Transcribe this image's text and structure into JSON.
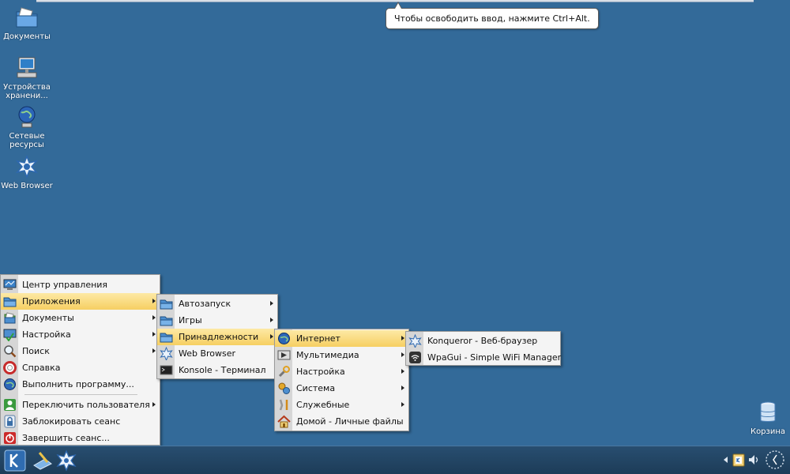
{
  "tooltip": {
    "text": "Чтобы освободить ввод, нажмите Ctrl+Alt."
  },
  "desktop": {
    "icons": [
      {
        "label": "Документы",
        "icon": "folder-documents-icon"
      },
      {
        "label": "Устройства хранени...",
        "icon": "storage-devices-icon"
      },
      {
        "label": "Сетевые ресурсы",
        "icon": "network-resources-icon"
      },
      {
        "label": "Web Browser",
        "icon": "konqueror-icon"
      },
      {
        "label": "Корзина",
        "icon": "trash-icon"
      }
    ]
  },
  "start_menu": {
    "items": [
      {
        "label": "Центр управления",
        "icon": "control-center-icon"
      },
      {
        "label": "Приложения",
        "icon": "applications-folder-icon"
      },
      {
        "label": "Документы",
        "icon": "documents-icon"
      },
      {
        "label": "Настройка",
        "icon": "settings-icon"
      },
      {
        "label": "Поиск",
        "icon": "search-icon"
      },
      {
        "label": "Справка",
        "icon": "help-icon"
      },
      {
        "label": "Выполнить программу...",
        "icon": "run-program-icon"
      },
      {
        "label": "Переключить пользователя",
        "icon": "switch-user-icon"
      },
      {
        "label": "Заблокировать сеанс",
        "icon": "lock-icon"
      },
      {
        "label": "Завершить сеанс...",
        "icon": "logout-icon"
      }
    ]
  },
  "applications_menu": {
    "items": [
      {
        "label": "Автозапуск",
        "icon": "folder-icon"
      },
      {
        "label": "Игры",
        "icon": "folder-icon"
      },
      {
        "label": "Принадлежности",
        "icon": "folder-icon"
      },
      {
        "label": "Web Browser",
        "icon": "konqueror-icon"
      },
      {
        "label": "Konsole - Терминал",
        "icon": "terminal-icon"
      }
    ]
  },
  "accessories_menu": {
    "items": [
      {
        "label": "Интернет",
        "icon": "internet-icon"
      },
      {
        "label": "Мультимедиа",
        "icon": "multimedia-icon"
      },
      {
        "label": "Настройка",
        "icon": "wrench-icon"
      },
      {
        "label": "Система",
        "icon": "system-icon"
      },
      {
        "label": "Служебные",
        "icon": "utilities-icon"
      },
      {
        "label": "Домой - Личные файлы",
        "icon": "home-icon"
      }
    ]
  },
  "internet_menu": {
    "items": [
      {
        "label": "Konqueror - Веб-браузер",
        "icon": "konqueror-icon"
      },
      {
        "label": "WpaGui - Simple WiFi Manager",
        "icon": "wifi-icon"
      }
    ]
  },
  "taskbar": {
    "launchers": [
      "kde-start-icon",
      "desktop-icon",
      "konqueror-icon"
    ],
    "tray": [
      "tray-arrow-icon",
      "klipper-icon",
      "volume-icon",
      "clock-icon"
    ]
  },
  "colors": {
    "desktop": "#336a99",
    "highlight": "#f6cf62",
    "taskbar": "#1d3c58"
  }
}
